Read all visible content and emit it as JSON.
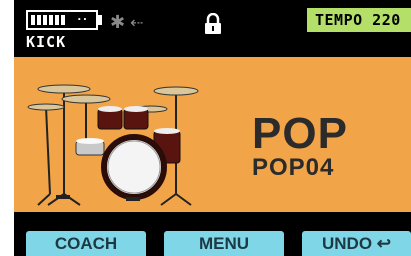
{
  "status": {
    "kit_label": "KICK",
    "battery_dots": "··",
    "bluetooth_icon": "bluetooth-icon",
    "usb_icon": "usb-icon",
    "lock_icon": "lock-icon",
    "tempo_label": "TEMPO 220"
  },
  "main": {
    "genre": "POP",
    "preset": "POP04",
    "image": "drum-kit-image"
  },
  "buttons": {
    "coach": "COACH",
    "menu": "MENU",
    "undo": "UNDO ↩"
  },
  "colors": {
    "panel": "#f2a448",
    "tempo_bg": "#b4e06a",
    "button_bg": "#7fd6e6",
    "background": "#000000"
  }
}
